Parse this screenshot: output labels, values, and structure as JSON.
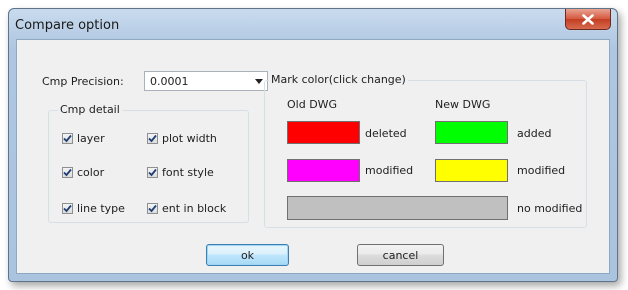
{
  "window": {
    "title": "Compare option",
    "close_icon": "close-icon"
  },
  "precision": {
    "label": "Cmp Precision:",
    "value": "0.0001"
  },
  "cmp_detail": {
    "title": "Cmp detail",
    "options": [
      {
        "label": "layer",
        "checked": true
      },
      {
        "label": "plot width",
        "checked": true
      },
      {
        "label": "color",
        "checked": true
      },
      {
        "label": "font style",
        "checked": true
      },
      {
        "label": "line type",
        "checked": true
      },
      {
        "label": "ent in block",
        "checked": true
      }
    ]
  },
  "mark_color": {
    "title": "Mark color(click change)",
    "old_header": "Old DWG",
    "new_header": "New DWG",
    "deleted_label": "deleted",
    "deleted_color": "#ff0000",
    "old_modified_label": "modified",
    "old_modified_color": "#ff00ff",
    "added_label": "added",
    "added_color": "#00ff00",
    "new_modified_label": "modified",
    "new_modified_color": "#ffff00",
    "no_modified_label": "no modified",
    "no_modified_color": "#c0c0c0"
  },
  "buttons": {
    "ok": "ok",
    "cancel": "cancel"
  }
}
